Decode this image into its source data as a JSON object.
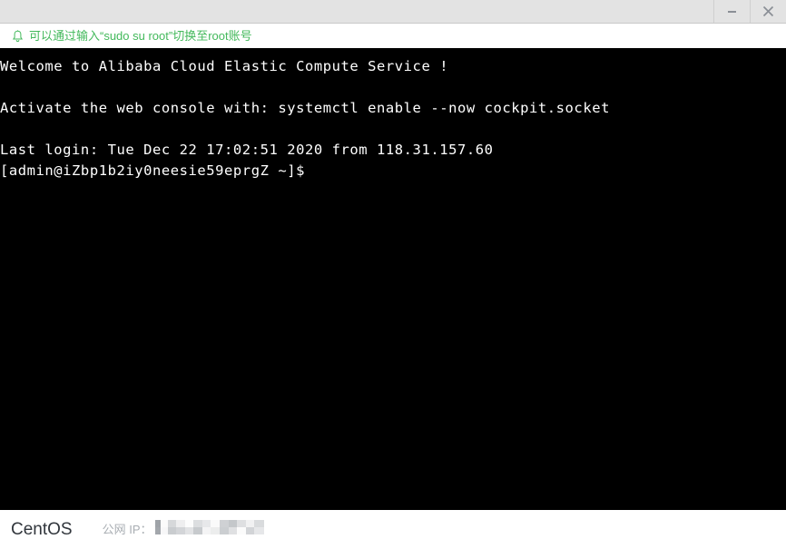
{
  "titlebar": {
    "minimize_label": "Minimize",
    "close_label": "Close"
  },
  "notice": {
    "icon": "bell-icon",
    "text": "可以通过输入“sudo su root”切换至root账号",
    "color": "#43b95b"
  },
  "terminal": {
    "background": "#000000",
    "foreground": "#ffffff",
    "lines": [
      "Welcome to Alibaba Cloud Elastic Compute Service !",
      "",
      "Activate the web console with: systemctl enable --now cockpit.socket",
      "",
      "Last login: Tue Dec 22 17:02:51 2020 from 118.31.157.60",
      "[admin@iZbp1b2iy0neesie59eprgZ ~]$"
    ]
  },
  "statusbar": {
    "os_name": "CentOS",
    "ip_label": "公网 IP：",
    "ip_value_redacted": true
  }
}
